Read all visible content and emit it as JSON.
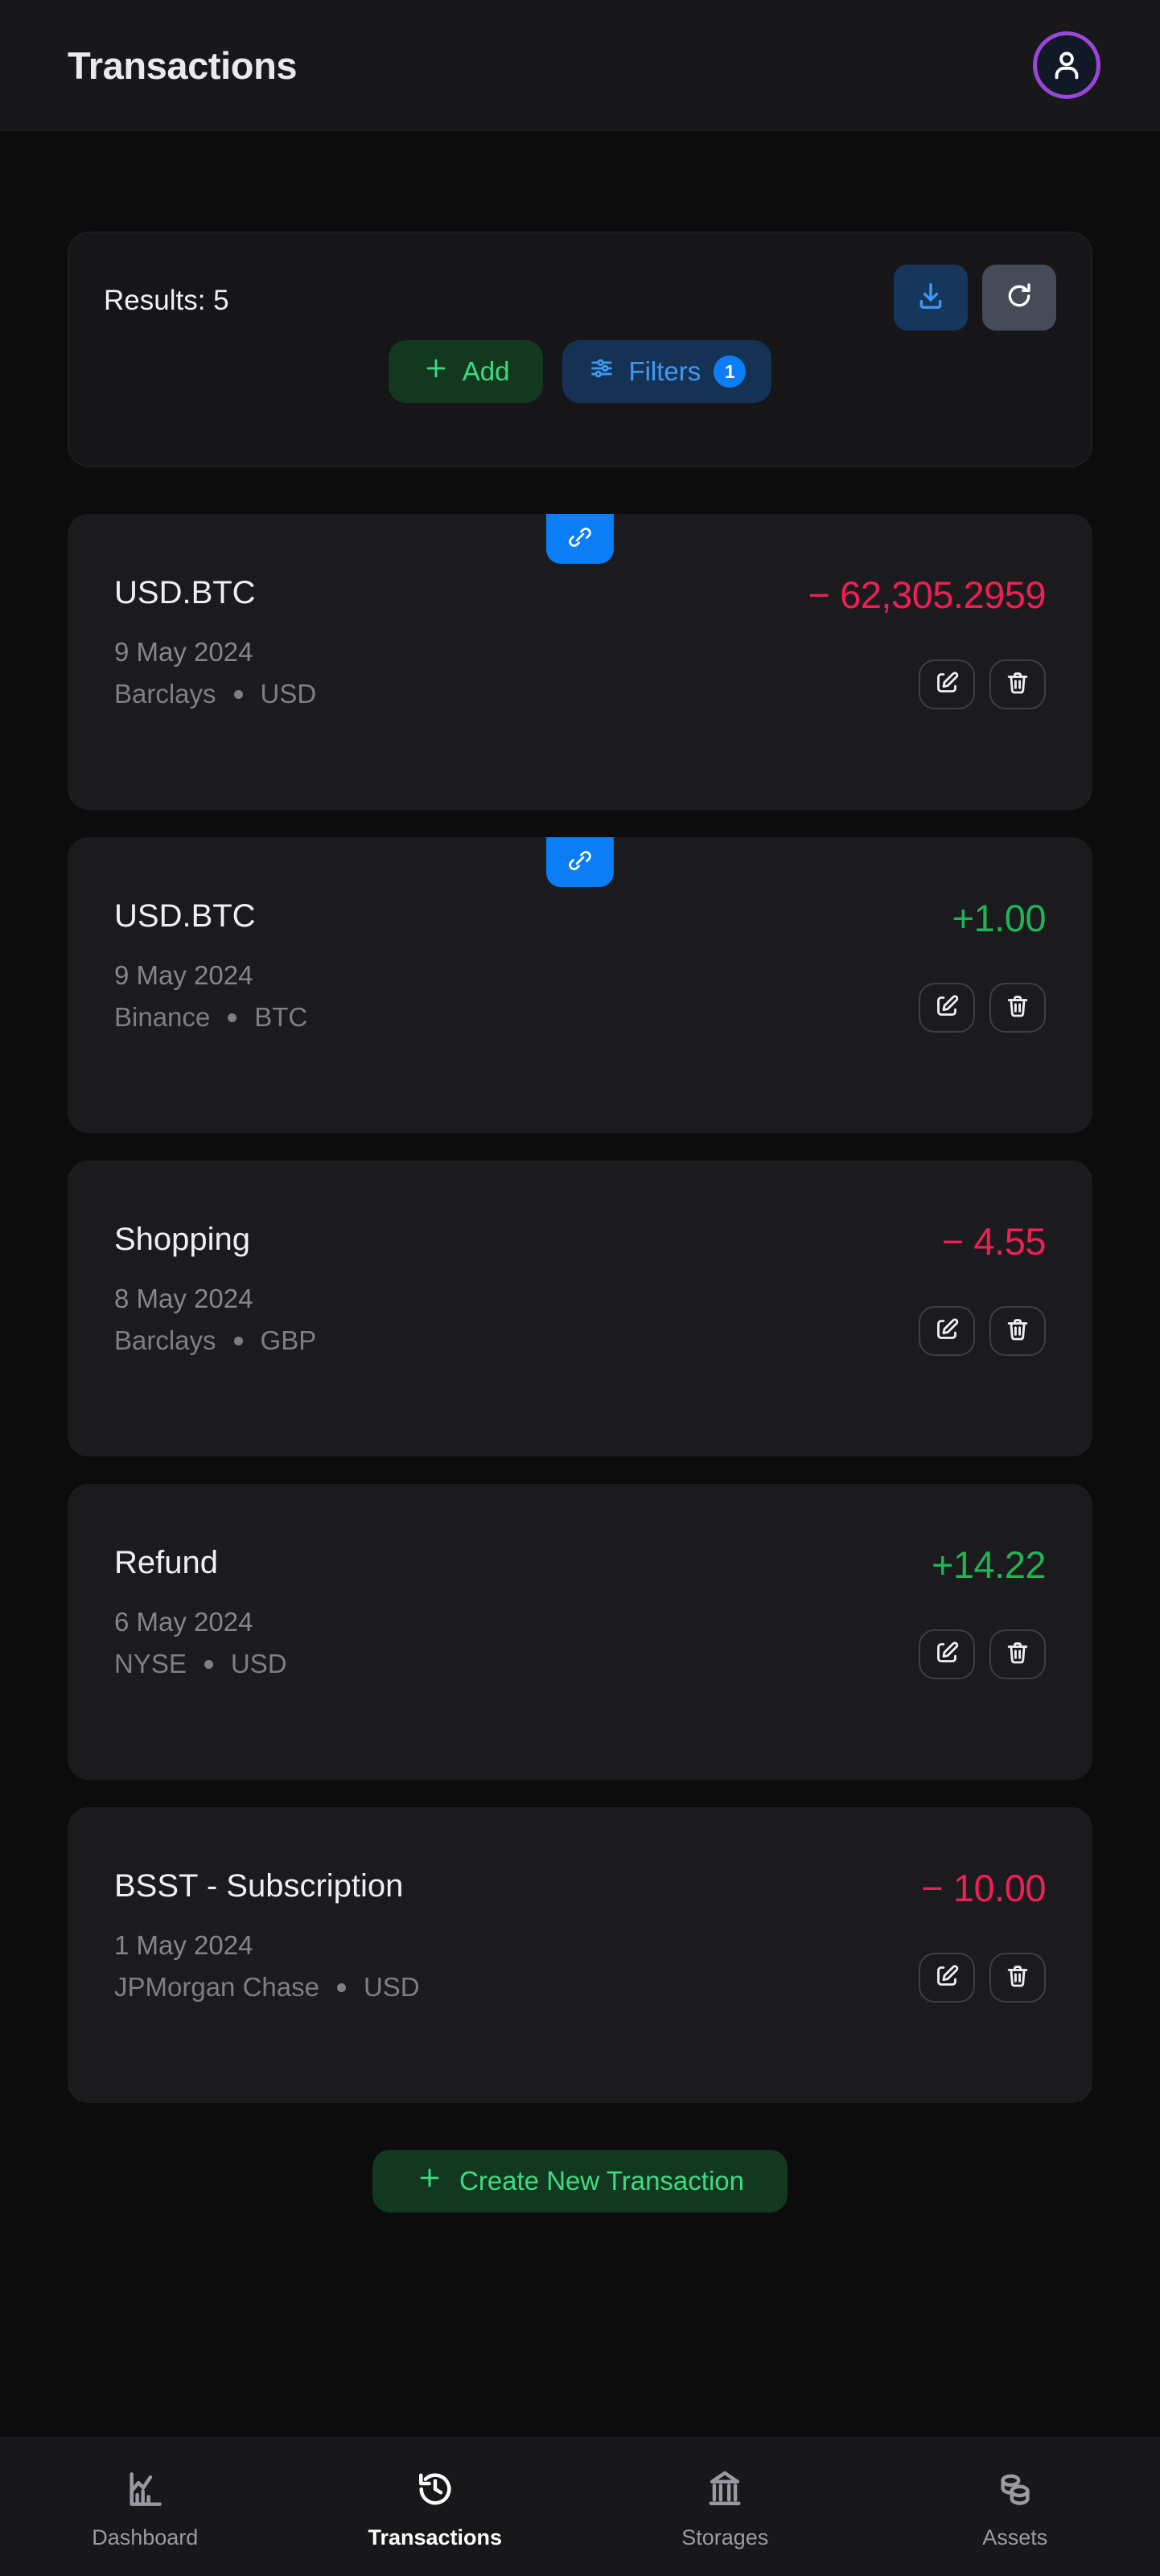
{
  "header": {
    "title": "Transactions",
    "avatar_icon": "user-avatar-icon"
  },
  "toolbar": {
    "results_label": "Results: 5",
    "download_icon": "download-icon",
    "refresh_icon": "refresh-icon",
    "add_label": "Add",
    "add_icon": "plus-icon",
    "filters_label": "Filters",
    "filters_icon": "sliders-icon",
    "filters_badge": "1",
    "colors": {
      "download_bg": "#16365e",
      "refresh_bg": "#454b58",
      "add_bg": "#12381f",
      "add_fg": "#3ddc7f",
      "filters_bg": "#153254",
      "filters_fg": "#3e9bf5",
      "badge_bg": "#0b7ef5"
    }
  },
  "transactions": [
    {
      "title": "USD.BTC",
      "amount": "− 62,305.2959",
      "sign": "neg",
      "date": "9 May 2024",
      "storage": "Barclays",
      "currency": "USD",
      "linked": true
    },
    {
      "title": "USD.BTC",
      "amount": "+1.00",
      "sign": "pos",
      "date": "9 May 2024",
      "storage": "Binance",
      "currency": "BTC",
      "linked": true
    },
    {
      "title": "Shopping",
      "amount": "− 4.55",
      "sign": "neg",
      "date": "8 May 2024",
      "storage": "Barclays",
      "currency": "GBP",
      "linked": false
    },
    {
      "title": "Refund",
      "amount": "+14.22",
      "sign": "pos",
      "date": "6 May 2024",
      "storage": "NYSE",
      "currency": "USD",
      "linked": false
    },
    {
      "title": "BSST - Subscription",
      "amount": "− 10.00",
      "sign": "neg",
      "date": "1 May 2024",
      "storage": "JPMorgan Chase",
      "currency": "USD",
      "linked": false
    }
  ],
  "row_actions": {
    "edit_icon": "edit-pencil-icon",
    "delete_icon": "trash-icon",
    "link_icon": "link-icon"
  },
  "cta": {
    "label": "Create New Transaction",
    "icon": "plus-icon"
  },
  "bottom_nav": {
    "items": [
      {
        "label": "Dashboard",
        "icon": "chart-icon",
        "active": false
      },
      {
        "label": "Transactions",
        "icon": "history-icon",
        "active": true
      },
      {
        "label": "Storages",
        "icon": "bank-icon",
        "active": false
      },
      {
        "label": "Assets",
        "icon": "coins-icon",
        "active": false
      }
    ]
  },
  "colors": {
    "page_bg": "#0c0c0d",
    "card_bg": "#1b1b1d",
    "surface_bg": "#18181a",
    "negative": "#f01f56",
    "positive": "#20b455",
    "accent_blue": "#0b7ef5",
    "avatar_ring": "#9b46d8"
  }
}
